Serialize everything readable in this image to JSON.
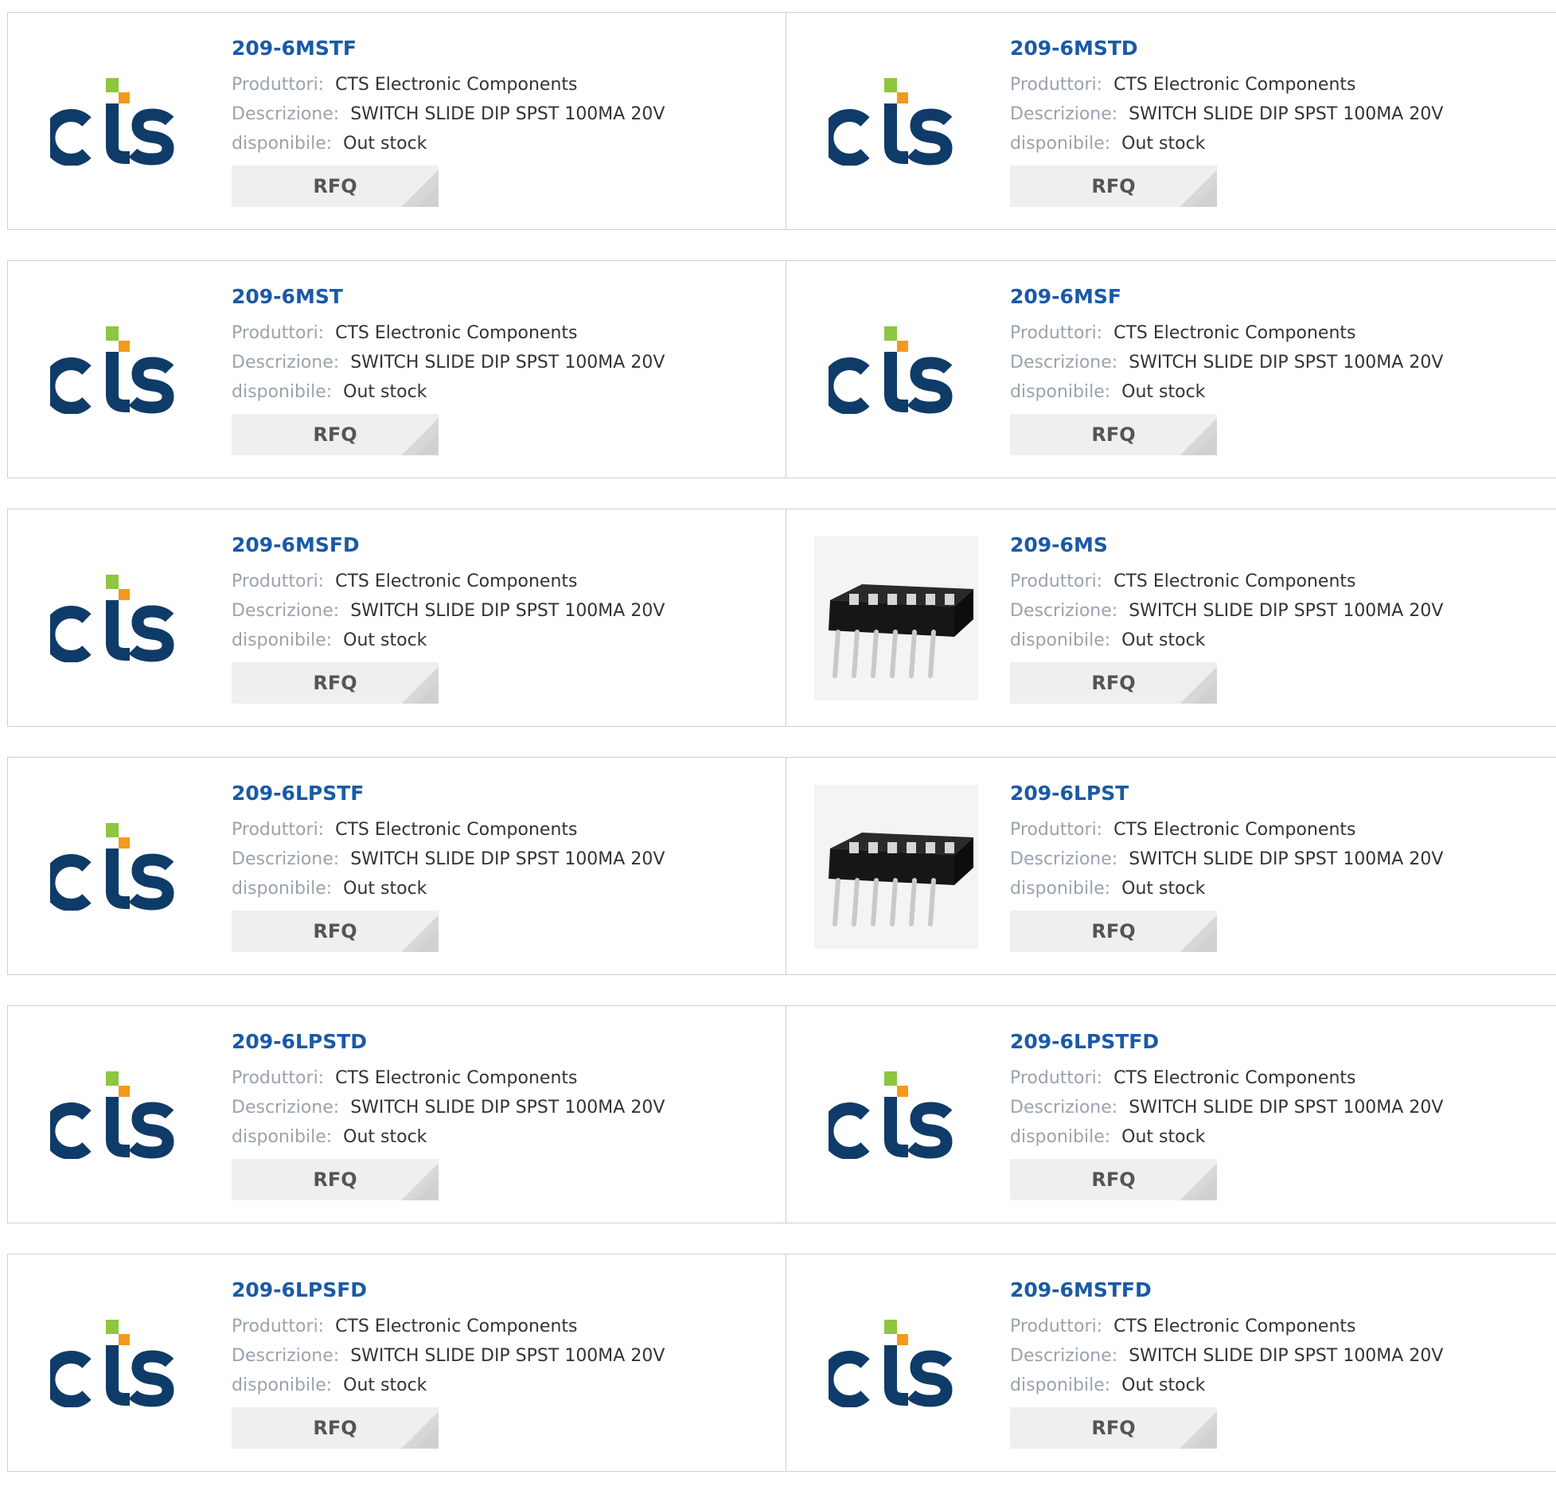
{
  "labels": {
    "manufacturer": "Produttori:",
    "description": "Descrizione:",
    "availability": "disponibile:",
    "rfq": "RFQ"
  },
  "colors": {
    "part_link": "#1a5aa6",
    "label": "#9aa3ad",
    "logo_navy": "#0f3b68",
    "logo_green": "#8dc63f",
    "logo_orange": "#f39a1c"
  },
  "products": [
    {
      "part": "209-6MSTF",
      "manufacturer": "CTS Electronic Components",
      "description": "SWITCH SLIDE DIP SPST 100MA 20V",
      "availability": "Out stock",
      "image": "cts-logo"
    },
    {
      "part": "209-6MSTD",
      "manufacturer": "CTS Electronic Components",
      "description": "SWITCH SLIDE DIP SPST 100MA 20V",
      "availability": "Out stock",
      "image": "cts-logo"
    },
    {
      "part": "209-6MST",
      "manufacturer": "CTS Electronic Components",
      "description": "SWITCH SLIDE DIP SPST 100MA 20V",
      "availability": "Out stock",
      "image": "cts-logo"
    },
    {
      "part": "209-6MSF",
      "manufacturer": "CTS Electronic Components",
      "description": "SWITCH SLIDE DIP SPST 100MA 20V",
      "availability": "Out stock",
      "image": "cts-logo"
    },
    {
      "part": "209-6MSFD",
      "manufacturer": "CTS Electronic Components",
      "description": "SWITCH SLIDE DIP SPST 100MA 20V",
      "availability": "Out stock",
      "image": "cts-logo"
    },
    {
      "part": "209-6MS",
      "manufacturer": "CTS Electronic Components",
      "description": "SWITCH SLIDE DIP SPST 100MA 20V",
      "availability": "Out stock",
      "image": "dip-switch-photo"
    },
    {
      "part": "209-6LPSTF",
      "manufacturer": "CTS Electronic Components",
      "description": "SWITCH SLIDE DIP SPST 100MA 20V",
      "availability": "Out stock",
      "image": "cts-logo"
    },
    {
      "part": "209-6LPST",
      "manufacturer": "CTS Electronic Components",
      "description": "SWITCH SLIDE DIP SPST 100MA 20V",
      "availability": "Out stock",
      "image": "dip-switch-photo"
    },
    {
      "part": "209-6LPSTD",
      "manufacturer": "CTS Electronic Components",
      "description": "SWITCH SLIDE DIP SPST 100MA 20V",
      "availability": "Out stock",
      "image": "cts-logo"
    },
    {
      "part": "209-6LPSTFD",
      "manufacturer": "CTS Electronic Components",
      "description": "SWITCH SLIDE DIP SPST 100MA 20V",
      "availability": "Out stock",
      "image": "cts-logo"
    },
    {
      "part": "209-6LPSFD",
      "manufacturer": "CTS Electronic Components",
      "description": "SWITCH SLIDE DIP SPST 100MA 20V",
      "availability": "Out stock",
      "image": "cts-logo"
    },
    {
      "part": "209-6MSTFD",
      "manufacturer": "CTS Electronic Components",
      "description": "SWITCH SLIDE DIP SPST 100MA 20V",
      "availability": "Out stock",
      "image": "cts-logo"
    }
  ]
}
